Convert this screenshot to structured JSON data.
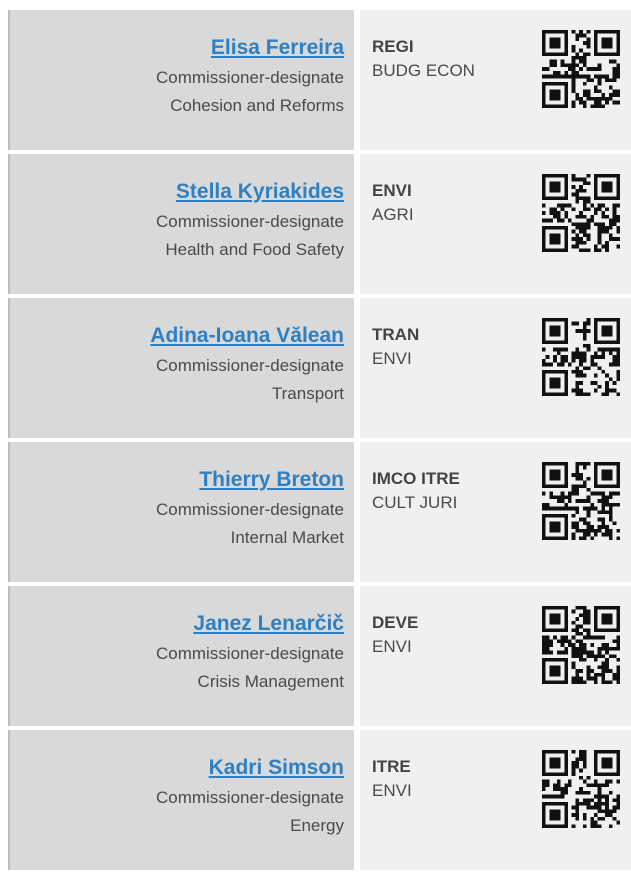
{
  "commissioners": [
    {
      "name": "Elisa Ferreira",
      "role": "Commissioner-designate",
      "portfolio": "Cohesion and Reforms",
      "main_committee": "REGI",
      "associated_committees": "BUDG ECON"
    },
    {
      "name": "Stella Kyriakides",
      "role": "Commissioner-designate",
      "portfolio": "Health and Food Safety",
      "main_committee": "ENVI",
      "associated_committees": "AGRI"
    },
    {
      "name": "Adina-Ioana Vălean",
      "role": "Commissioner-designate",
      "portfolio": "Transport",
      "main_committee": "TRAN",
      "associated_committees": "ENVI"
    },
    {
      "name": "Thierry Breton",
      "role": "Commissioner-designate",
      "portfolio": "Internal Market",
      "main_committee": "IMCO ITRE",
      "associated_committees": "CULT JURI"
    },
    {
      "name": "Janez Lenarčič",
      "role": "Commissioner-designate",
      "portfolio": "Crisis Management",
      "main_committee": "DEVE",
      "associated_committees": "ENVI"
    },
    {
      "name": "Kadri Simson",
      "role": "Commissioner-designate",
      "portfolio": "Energy",
      "main_committee": "ITRE",
      "associated_committees": "ENVI"
    }
  ],
  "colors": {
    "link": "#2f80c2",
    "left_panel": "#d9d9d9",
    "right_panel": "#f0f0f0",
    "text": "#4a4a4a"
  },
  "icons": {
    "qr": "qr-code-icon"
  }
}
